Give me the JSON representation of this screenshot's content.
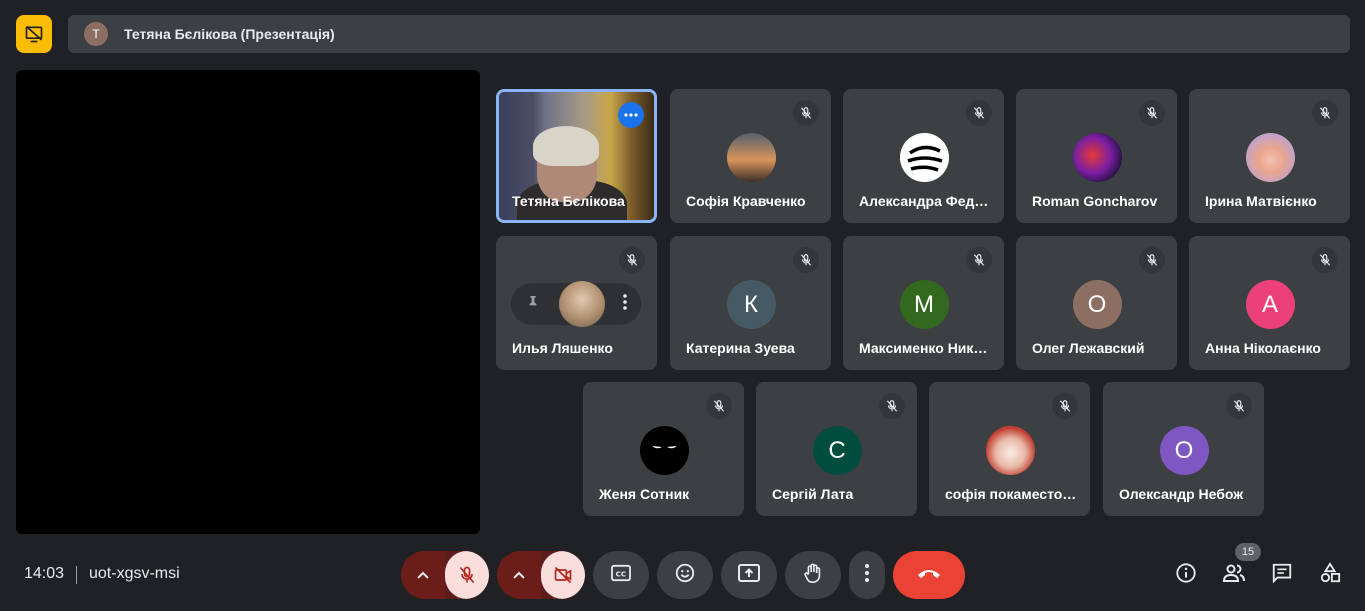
{
  "banner": {
    "avatar_letter": "T",
    "presenter_text": "Тетяна Бєлікова (Презентація)"
  },
  "tiles": [
    {
      "name": "Тетяна Бєлікова",
      "type": "video",
      "active": true
    },
    {
      "name": "Софія Кравченко",
      "type": "photo"
    },
    {
      "name": "Александра Фед…",
      "type": "photo"
    },
    {
      "name": "Roman Goncharov",
      "type": "photo"
    },
    {
      "name": "Ірина Матвієнко",
      "type": "photo"
    },
    {
      "name": "Илья Ляшенко",
      "type": "photo"
    },
    {
      "name": "Катерина Зуева",
      "type": "letter",
      "letter": "К",
      "color": "#455a64"
    },
    {
      "name": "Максименко Ник…",
      "type": "letter",
      "letter": "М",
      "color": "#33691e"
    },
    {
      "name": "Олег Лежавский",
      "type": "letter",
      "letter": "О",
      "color": "#8d6e63"
    },
    {
      "name": "Анна Ніколаєнко",
      "type": "letter",
      "letter": "А",
      "color": "#ec407a"
    },
    {
      "name": "Женя Сотник",
      "type": "photo"
    },
    {
      "name": "Сергій Лата",
      "type": "letter",
      "letter": "С",
      "color": "#004d40"
    },
    {
      "name": "софія покаместо…",
      "type": "photo"
    },
    {
      "name": "Олександр Небож",
      "type": "letter",
      "letter": "О",
      "color": "#7e57c2"
    }
  ],
  "meeting": {
    "time": "14:03",
    "code": "uot-xgsv-msi",
    "participant_count": "15"
  },
  "colors": {
    "accent": "#8ab4f8",
    "end_call": "#ea4335",
    "present_badge": "#fbbc04",
    "mic_off_bg": "#f9dedc"
  },
  "icons": [
    "present-icon",
    "mic-off-icon",
    "video-off-icon",
    "captions-icon",
    "emoji-icon",
    "present-screen-icon",
    "raise-hand-icon",
    "more-vert-icon",
    "end-call-icon",
    "info-icon",
    "people-icon",
    "chat-icon",
    "activities-icon",
    "pin-icon"
  ]
}
